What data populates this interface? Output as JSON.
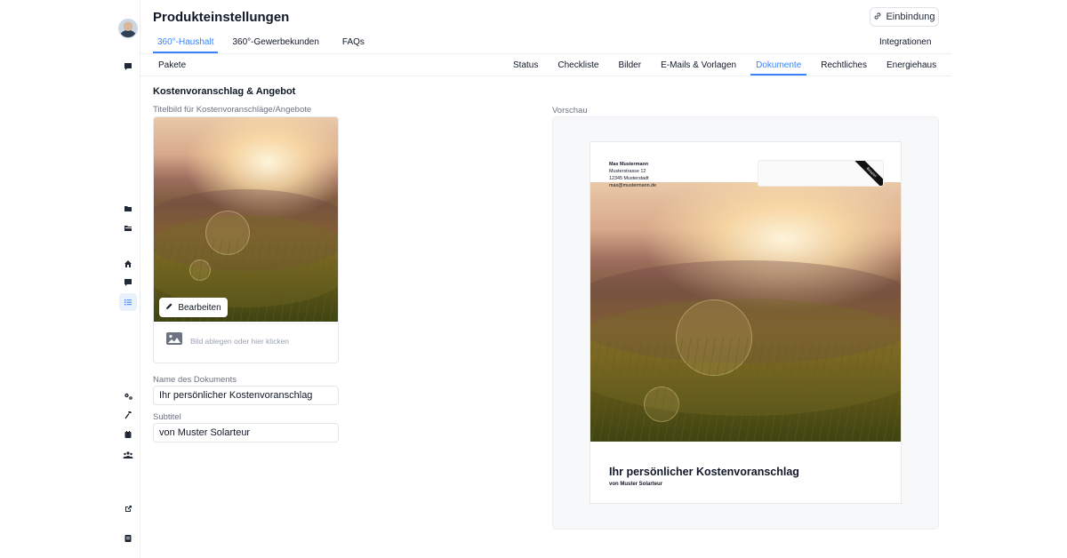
{
  "header": {
    "title": "Produkteinstellungen",
    "embed_label": "Einbindung",
    "integrations_label": "Integrationen"
  },
  "tabs_primary": [
    {
      "label": "360°-Haushalt",
      "active": true
    },
    {
      "label": "360°-Gewerbekunden",
      "active": false
    },
    {
      "label": "FAQs",
      "active": false
    }
  ],
  "subnav": {
    "left_label": "Pakete",
    "tabs": [
      {
        "label": "Status",
        "active": false
      },
      {
        "label": "Checkliste",
        "active": false
      },
      {
        "label": "Bilder",
        "active": false
      },
      {
        "label": "E-Mails & Vorlagen",
        "active": false
      },
      {
        "label": "Dokumente",
        "active": true
      },
      {
        "label": "Rechtliches",
        "active": false
      },
      {
        "label": "Energiehaus",
        "active": false
      }
    ]
  },
  "section": {
    "title": "Kostenvoranschlag & Angebot",
    "cover_label": "Titelbild für Kostenvoranschläge/Angebote",
    "edit_button": "Bearbeiten",
    "dropzone_text": "Bild ablegen oder hier klicken",
    "doc_name_label": "Name des Dokuments",
    "doc_name_value": "Ihr persönlicher Kostenvoranschlag",
    "subtitle_label": "Subtitel",
    "subtitle_value": "von Muster Solarteur"
  },
  "preview": {
    "label": "Vorschau",
    "sender_name": "Max Mustermann",
    "sender_street": "Musterstrasse 12",
    "sender_city": "12345 Musterstadt",
    "sender_email": "max@mustermann.de",
    "ribbon_text": "Beispiel",
    "doc_title": "Ihr persönlicher Kostenvoranschlag",
    "doc_subtitle": "von Muster Solarteur"
  },
  "colors": {
    "accent": "#3b82f6",
    "text": "#111827",
    "muted": "#6b7280"
  },
  "icons": [
    "avatar",
    "chat-icon",
    "folder-icon",
    "folder-open-icon",
    "home-icon",
    "message-icon",
    "list-icon",
    "settings-icon",
    "hammer-icon",
    "calendar-icon",
    "users-icon",
    "external-link-icon",
    "book-icon",
    "link-icon",
    "pencil-icon",
    "image-icon"
  ]
}
